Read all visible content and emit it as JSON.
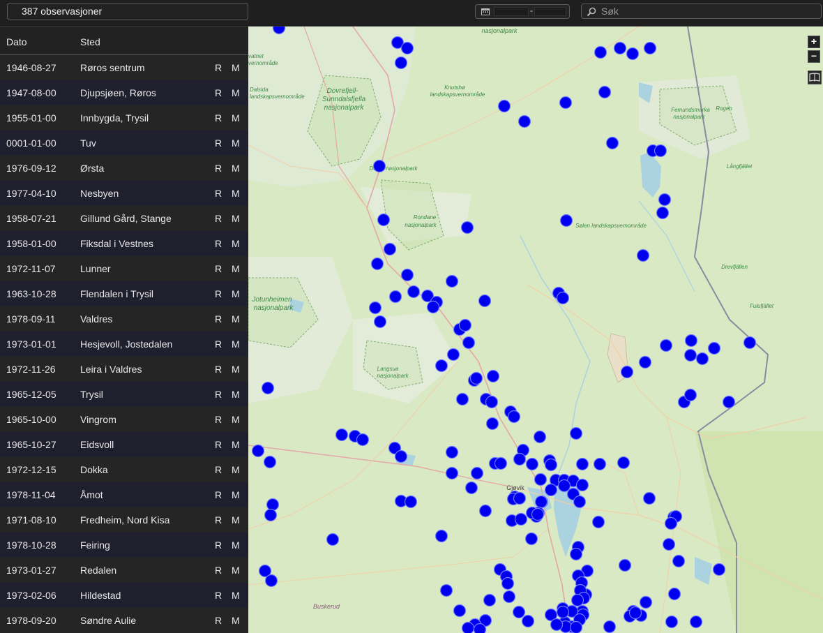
{
  "header": {
    "observation_count": "387 observasjoner",
    "search_placeholder": "Søk",
    "date_separator": "-"
  },
  "table": {
    "columns": {
      "date": "Dato",
      "place": "Sted"
    },
    "rows": [
      {
        "date": "1946-08-27",
        "place": "Røros sentrum",
        "r": "R",
        "m": "M"
      },
      {
        "date": "1947-08-00",
        "place": "Djupsjøen, Røros",
        "r": "R",
        "m": "M"
      },
      {
        "date": "1955-01-00",
        "place": "Innbygda, Trysil",
        "r": "R",
        "m": "M"
      },
      {
        "date": "0001-01-00",
        "place": "Tuv",
        "r": "R",
        "m": "M"
      },
      {
        "date": "1976-09-12",
        "place": "Ørsta",
        "r": "R",
        "m": "M"
      },
      {
        "date": "1977-04-10",
        "place": "Nesbyen",
        "r": "R",
        "m": "M"
      },
      {
        "date": "1958-07-21",
        "place": "Gillund Gård, Stange",
        "r": "R",
        "m": "M"
      },
      {
        "date": "1958-01-00",
        "place": "Fiksdal i Vestnes",
        "r": "R",
        "m": "M"
      },
      {
        "date": "1972-11-07",
        "place": "Lunner",
        "r": "R",
        "m": "M"
      },
      {
        "date": "1963-10-28",
        "place": "Flendalen i Trysil",
        "r": "R",
        "m": "M"
      },
      {
        "date": "1978-09-11",
        "place": "Valdres",
        "r": "R",
        "m": "M"
      },
      {
        "date": "1973-01-01",
        "place": "Hesjevoll, Jostedalen",
        "r": "R",
        "m": "M"
      },
      {
        "date": "1972-11-26",
        "place": "Leira i Valdres",
        "r": "R",
        "m": "M"
      },
      {
        "date": "1965-12-05",
        "place": "Trysil",
        "r": "R",
        "m": "M"
      },
      {
        "date": "1965-10-00",
        "place": "Vingrom",
        "r": "R",
        "m": "M"
      },
      {
        "date": "1965-10-27",
        "place": "Eidsvoll",
        "r": "R",
        "m": "M"
      },
      {
        "date": "1972-12-15",
        "place": "Dokka",
        "r": "R",
        "m": "M"
      },
      {
        "date": "1978-11-04",
        "place": "Åmot",
        "r": "R",
        "m": "M"
      },
      {
        "date": "1971-08-10",
        "place": "Fredheim, Nord Kisa",
        "r": "R",
        "m": "M"
      },
      {
        "date": "1978-10-28",
        "place": "Feiring",
        "r": "R",
        "m": "M"
      },
      {
        "date": "1973-01-27",
        "place": "Redalen",
        "r": "R",
        "m": "M"
      },
      {
        "date": "1973-02-06",
        "place": "Hildestad",
        "r": "R",
        "m": "M"
      },
      {
        "date": "1978-09-20",
        "place": "Søndre Aulie",
        "r": "R",
        "m": "M"
      }
    ]
  },
  "map": {
    "zoom_in": "+",
    "zoom_out": "−",
    "marker_color": "#0000ee",
    "labels": [
      "nasjonalpark",
      "vatnet",
      "vernområde",
      "Dovrefjell-",
      "Sunndalsfjella",
      "nasjonalpark",
      "Knutshø",
      "landskapsvernområde",
      "Dalsida",
      "landskapsvernområde",
      "Femundsmarka",
      "nasjonalpark",
      "Rogen",
      "Dovre nasjonalpark",
      "Långfjället",
      "Rondane",
      "nasjonalpark",
      "Sølen landskapsvernområde",
      "Drevfjällen",
      "Jotunheimen",
      "nasjonalpark",
      "Fulufjället",
      "Langsua",
      "nasjonalpark",
      "Gjøvik",
      "Buskerud"
    ]
  }
}
